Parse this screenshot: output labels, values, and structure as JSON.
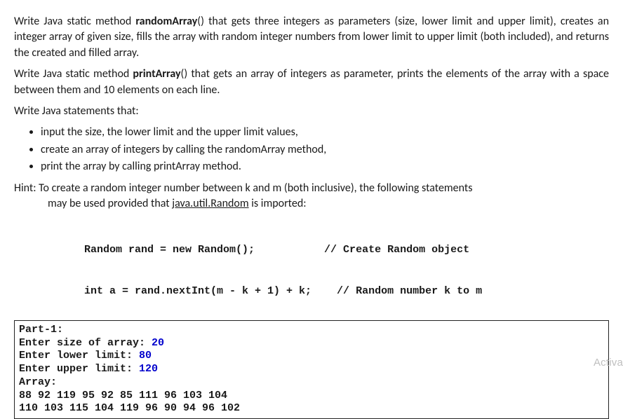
{
  "para1_pre": "Write Java static method ",
  "para1_method": "randomArray",
  "para1_post": "() that gets three integers as parameters (size, lower limit and upper limit), creates an integer array of given size, fills the array with random integer numbers from lower limit to upper limit (both included), and returns the created and filled array.",
  "para2_pre": "Write Java static method ",
  "para2_method": "printArray",
  "para2_post": "() that gets an array of integers as parameter, prints the elements of the array with a space between them and 10 elements on each line.",
  "para3": "Write Java statements that:",
  "bullets": [
    "input the size, the lower limit and the upper limit values,",
    "create an array of integers by calling the randomArray method,",
    "print the array by calling printArray method."
  ],
  "hint_line_main": "Hint: To create a random integer number between k and m (both inclusive), the following statements",
  "hint_line_sub_pre": "may be used provided that ",
  "hint_line_sub_link": "java.util.Random",
  "hint_line_sub_post": " is imported:",
  "code_line1": "Random rand = new Random();           // Create Random object",
  "code_line2": "int a = rand.nextInt(m - k + 1) + k;    // Random number k to m",
  "output": {
    "title": "Part-1:",
    "prompt_size": "Enter size of array: ",
    "val_size": "20",
    "prompt_lower": "Enter lower limit: ",
    "val_lower": "80",
    "prompt_upper": "Enter upper limit: ",
    "val_upper": "120",
    "array_label": "Array:",
    "row1": "88 92 119 95 92 85 111 96 103 104",
    "row2": "110 103 115 104 119 96 90 94 96 102"
  },
  "watermark": "Activa"
}
